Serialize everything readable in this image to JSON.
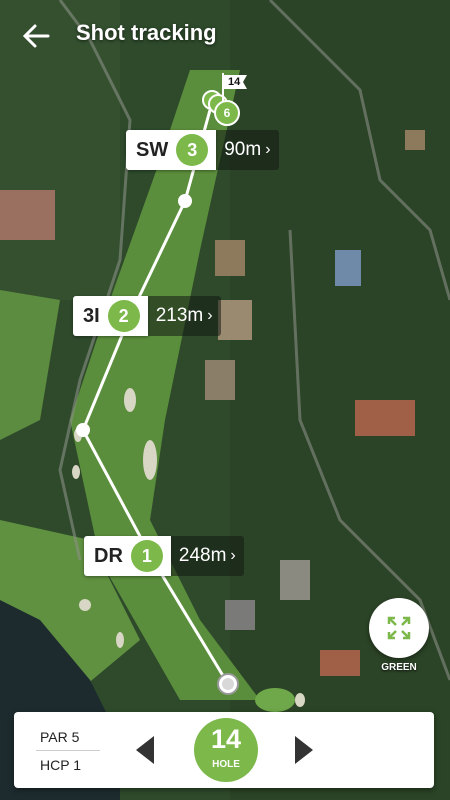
{
  "header": {
    "title": "Shot tracking"
  },
  "hole_flag": "14",
  "green_marker": "6",
  "shots": [
    {
      "club": "SW",
      "number": "3",
      "distance": "90m",
      "chevron": "›"
    },
    {
      "club": "3I",
      "number": "2",
      "distance": "213m",
      "chevron": "›"
    },
    {
      "club": "DR",
      "number": "1",
      "distance": "248m",
      "chevron": "›"
    }
  ],
  "green_button": {
    "label": "GREEN",
    "icon": "expand-icon"
  },
  "panel": {
    "par": "PAR  5",
    "hcp": "HCP  1",
    "hole_number": "14",
    "hole_label": "HOLE"
  },
  "colors": {
    "accent": "#7cb84a"
  }
}
